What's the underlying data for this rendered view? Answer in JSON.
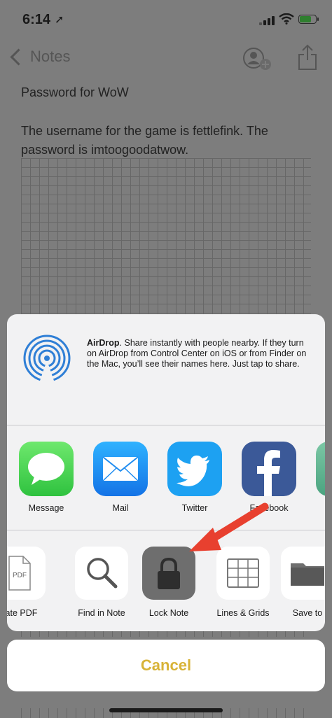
{
  "status_bar": {
    "time": "6:14"
  },
  "nav": {
    "back_label": "Notes"
  },
  "note": {
    "title": "Password for WoW",
    "body": "The username for the game is fettlefink. The password is imtoogoodatwow."
  },
  "airdrop": {
    "heading": "AirDrop",
    "description": ". Share instantly with people nearby. If they turn on AirDrop from Control Center on iOS or from Finder on the Mac, you’ll see their names here. Just tap to share."
  },
  "apps": [
    {
      "label": "Message",
      "color": "#4cd964"
    },
    {
      "label": "Mail",
      "color": "#1f8cf0"
    },
    {
      "label": "Twitter",
      "color": "#1da1f2"
    },
    {
      "label": "Facebook",
      "color": "#3b5998"
    }
  ],
  "actions": [
    {
      "label": "eate PDF",
      "tile_text": "PDF"
    },
    {
      "label": "Find in Note"
    },
    {
      "label": "Lock Note"
    },
    {
      "label": "Lines & Grids"
    },
    {
      "label": "Save to"
    }
  ],
  "cancel_label": "Cancel",
  "colors": {
    "accent": "#d8b338",
    "arrow": "#e8402f"
  }
}
